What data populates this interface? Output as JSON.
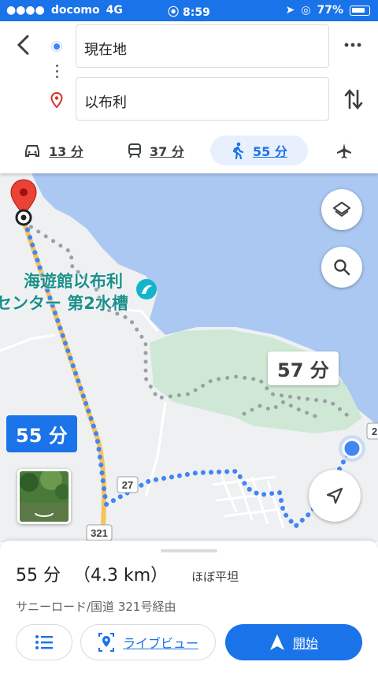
{
  "status": {
    "carrier": "docomo",
    "network": "4G",
    "time": "8:59",
    "battery": "77%"
  },
  "route_inputs": {
    "origin": "現在地",
    "destination": "以布利"
  },
  "modes": [
    {
      "icon": "car-icon",
      "label": "13 分"
    },
    {
      "icon": "train-icon",
      "label": "37 分"
    },
    {
      "icon": "walk-icon",
      "label": "55 分",
      "selected": true
    },
    {
      "icon": "flight-icon",
      "label": ""
    }
  ],
  "map": {
    "poi_line1": "海遊館以布利",
    "poi_line2": "センター 第2水槽",
    "route_badge_primary": "55 分",
    "route_badge_alt": "57 分",
    "road_27": "27",
    "road_321": "321",
    "road_edge": "2"
  },
  "summary": {
    "duration": "55 分",
    "distance": "（4.3 km）",
    "terrain": "ほぼ平坦",
    "via": "サニーロード/国道 321号経由"
  },
  "actions": {
    "steps_label": "",
    "live_view": "ライブビュー",
    "start": "開始"
  },
  "colors": {
    "accent": "#1a73e8",
    "water": "#aac8f2",
    "park": "#cfe8d5",
    "land": "#eef0f2"
  }
}
